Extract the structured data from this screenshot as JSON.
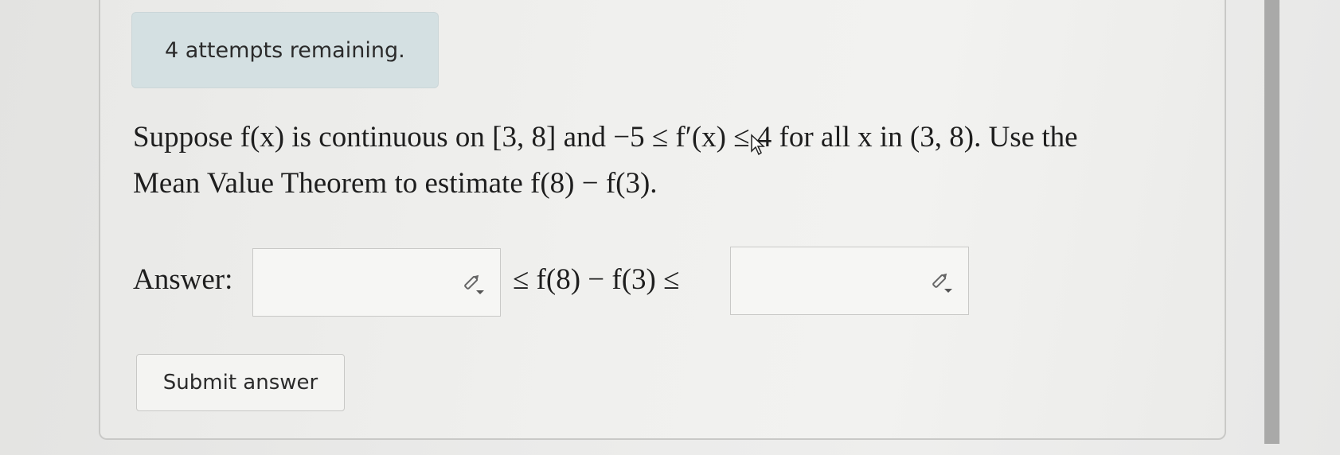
{
  "attempts": {
    "text": "4 attempts remaining."
  },
  "question": {
    "line1": "Suppose f(x) is continuous on [3, 8] and −5 ≤ f′(x) ≤ 4 for all x in (3, 8). Use the",
    "line2": "Mean Value Theorem to estimate f(8) − f(3)."
  },
  "answer": {
    "label": "Answer:",
    "lower_value": "",
    "middle_expression": "≤ f(8) − f(3) ≤",
    "upper_value": ""
  },
  "submit": {
    "label": "Submit answer"
  },
  "colors": {
    "attempts_bg": "#d4e0e2",
    "text": "#1e1e1e",
    "border": "#c9c9c7"
  },
  "icons": [
    "edit-pencil-icon",
    "mouse-cursor-icon"
  ]
}
